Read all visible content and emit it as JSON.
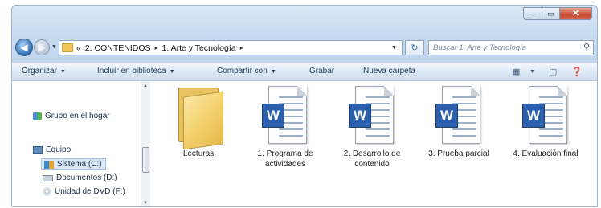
{
  "window": {
    "captions": {
      "minimize": "—",
      "maximize": "▭",
      "close": "✕"
    }
  },
  "address": {
    "overflow": "«",
    "breadcrumbs": [
      "2. CONTENIDOS",
      "1. Arte y Tecnología"
    ],
    "separator": "▸",
    "refresh": "↻",
    "search_placeholder": "Buscar 1. Arte y Tecnología",
    "search_icon": "magnifier-icon"
  },
  "toolbar": {
    "organize": "Organizar",
    "include_library": "Incluir en biblioteca",
    "share_with": "Compartir con",
    "burn": "Grabar",
    "new_folder": "Nueva carpeta"
  },
  "navpane": {
    "homegroup": "Grupo en el hogar",
    "computer": "Equipo",
    "drives": [
      "Sistema (C:)",
      "Documentos (D:)",
      "Unidad de DVD (F:)"
    ]
  },
  "files": [
    {
      "type": "folder",
      "name": "Lecturas"
    },
    {
      "type": "word",
      "name": "1. Programa de actividades"
    },
    {
      "type": "word",
      "name": "2. Desarrollo de contenido"
    },
    {
      "type": "word",
      "name": "3. Prueba parcial"
    },
    {
      "type": "word",
      "name": "4. Evaluación final"
    }
  ],
  "word_badge": "W",
  "colors": {
    "accent": "#2b5fab",
    "folder": "#f2cf6a",
    "chrome": "#c4d8ee"
  }
}
